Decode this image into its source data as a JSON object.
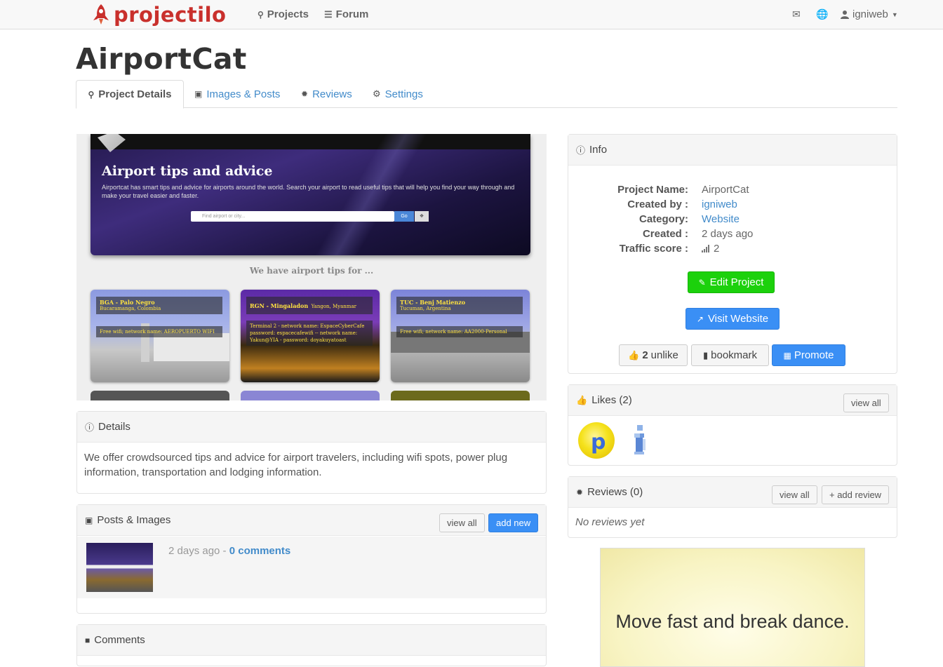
{
  "brand": {
    "name": "projectilo"
  },
  "nav": {
    "projects": "Projects",
    "forum": "Forum",
    "user": "igniweb"
  },
  "page": {
    "title": "AirportCat"
  },
  "tabs": [
    {
      "label": "Project Details"
    },
    {
      "label": "Images & Posts"
    },
    {
      "label": "Reviews"
    },
    {
      "label": "Settings"
    }
  ],
  "screenshot": {
    "hero_title": "Airport tips and advice",
    "hero_subtitle": "Airportcat has smart tips and advice for airports around the world. Search your airport to read useful tips that will help you find your way through and make your travel easier and faster.",
    "search_placeholder": "Find airport or city...",
    "search_button": "Go",
    "tips_label": "We have airport tips for ...",
    "airports": [
      {
        "code": "BGA - Palo Negro",
        "location": "Bucaramanga, Colombia",
        "note": "Free wifi; network name: AEROPUERTO WIFI"
      },
      {
        "code": "RGN - Mingaladon",
        "location": "Yangon, Myanmar",
        "note": "Terminal 2 - network name: EspaceCyberCafe password: espacecafewifi -- network name: Yakun@YIA - password: doyakuyatoast"
      },
      {
        "code": "TUC - Benj Matienzo",
        "location": "Tucuman, Argentina",
        "note": "Free wifi; network name: AA2000-Personal"
      }
    ]
  },
  "details": {
    "heading": "Details",
    "text": "We offer crowdsourced tips and advice for airport travelers, including wifi spots, power plug information, transportation and lodging information."
  },
  "posts": {
    "heading": "Posts & Images",
    "view_all": "view all",
    "add_new": "add new",
    "item_time": "2 days ago",
    "item_sep": " - ",
    "item_comments": "0 comments"
  },
  "comments": {
    "heading": "Comments"
  },
  "info": {
    "heading": "Info",
    "rows": [
      {
        "label": "Project Name:",
        "value": "AirportCat"
      },
      {
        "label": "Created by :",
        "value": "igniweb"
      },
      {
        "label": "Category:",
        "value": "Website"
      },
      {
        "label": "Created :",
        "value": "2 days ago"
      },
      {
        "label": "Traffic score :",
        "value": "2"
      }
    ],
    "edit_button": "Edit Project",
    "visit_button": "Visit Website",
    "like_count": "2",
    "unlike_label": "unlike",
    "bookmark_label": "bookmark",
    "promote_label": "Promote"
  },
  "likes": {
    "heading": "Likes (2)",
    "view_all": "view all"
  },
  "reviews": {
    "heading": "Reviews (0)",
    "view_all": "view all",
    "add_review": "+ add review",
    "empty": "No reviews yet"
  },
  "ad": {
    "text": "Move fast and break dance."
  },
  "colors": {
    "brand": "#c9302c",
    "link": "#428bca",
    "edit": "#1cd10c",
    "visit": "#3a8ff5",
    "promote": "#3a8ff5"
  }
}
